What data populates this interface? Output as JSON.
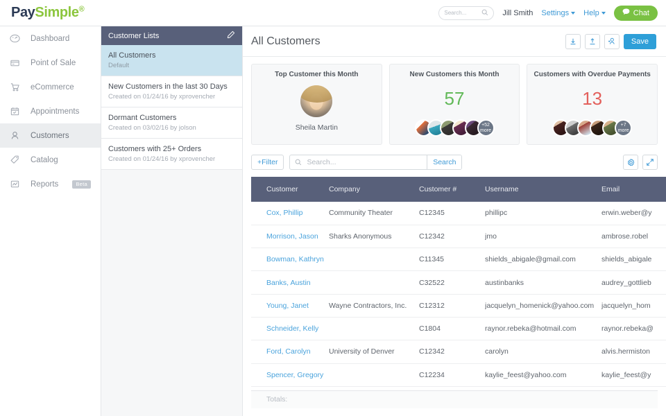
{
  "brand": {
    "part1": "Pay",
    "part2": "Simple",
    "green": "#8cc63e",
    "navy": "#2b3a55"
  },
  "header": {
    "search_placeholder": "Search...",
    "search_value": "",
    "user_name": "Jill Smith",
    "settings_label": "Settings",
    "help_label": "Help",
    "chat_label": "Chat"
  },
  "sidebar": {
    "items": [
      {
        "label": "Dashboard",
        "icon": "gauge-icon",
        "active": false,
        "badge": ""
      },
      {
        "label": "Point of Sale",
        "icon": "credit-card-icon",
        "active": false,
        "badge": ""
      },
      {
        "label": "eCommerce",
        "icon": "cart-icon",
        "active": false,
        "badge": ""
      },
      {
        "label": "Appointments",
        "icon": "calendar-icon",
        "active": false,
        "badge": ""
      },
      {
        "label": "Customers",
        "icon": "person-icon",
        "active": true,
        "badge": ""
      },
      {
        "label": "Catalog",
        "icon": "tag-icon",
        "active": false,
        "badge": ""
      },
      {
        "label": "Reports",
        "icon": "chart-icon",
        "active": false,
        "badge": "Beta"
      }
    ]
  },
  "list_panel": {
    "header_title": "Customer Lists",
    "edit_icon": "pencil-icon",
    "items": [
      {
        "title": "All Customers",
        "sub": "Default",
        "selected": true
      },
      {
        "title": "New Customers in the last 30 Days",
        "sub": "Created on 01/24/16 by xprovencher",
        "selected": false
      },
      {
        "title": "Dormant Customers",
        "sub": "Created on 03/02/16 by jolson",
        "selected": false
      },
      {
        "title": "Customers with 25+ Orders",
        "sub": "Created on 01/24/16 by xprovencher",
        "selected": false
      }
    ]
  },
  "main": {
    "title": "All Customers",
    "actions": {
      "import_icon": "download-icon",
      "export_icon": "upload-icon",
      "add_customer_icon": "add-person-icon",
      "save_label": "Save"
    },
    "cards": [
      {
        "title": "Top Customer this Month",
        "type": "photo",
        "name": "Sheila Martin"
      },
      {
        "title": "New Customers this Month",
        "type": "count",
        "value": "57",
        "color": "#62b959",
        "more": "+52",
        "more_label": "more"
      },
      {
        "title": "Customers with Overdue Payments",
        "type": "count",
        "value": "13",
        "color": "#e3605c",
        "more": "+7",
        "more_label": "more"
      }
    ],
    "toolbar": {
      "filter_label": "+Filter",
      "search_placeholder": "Search...",
      "search_value": "",
      "search_button": "Search",
      "settings_icon": "gear-icon",
      "expand_icon": "expand-icon"
    },
    "table": {
      "columns": [
        "Customer",
        "Company",
        "Customer #",
        "Username",
        "Email"
      ],
      "rows": [
        {
          "customer": "Cox, Phillip",
          "company": "Community Theater",
          "number": "C12345",
          "username": "phillipc",
          "email": "erwin.weber@y"
        },
        {
          "customer": "Morrison, Jason",
          "company": "Sharks Anonymous",
          "number": "C12342",
          "username": "jmo",
          "email": "ambrose.robel"
        },
        {
          "customer": "Bowman, Kathryn",
          "company": "",
          "number": "C11345",
          "username": "shields_abigale@gmail.com",
          "email": "shields_abigale"
        },
        {
          "customer": "Banks, Austin",
          "company": "",
          "number": "C32522",
          "username": "austinbanks",
          "email": "audrey_gottlieb"
        },
        {
          "customer": "Young, Janet",
          "company": "Wayne Contractors, Inc.",
          "number": "C12312",
          "username": "jacquelyn_homenick@yahoo.com",
          "email": "jacquelyn_hom"
        },
        {
          "customer": "Schneider, Kelly",
          "company": "",
          "number": "C1804",
          "username": "raynor.rebeka@hotmail.com",
          "email": "raynor.rebeka@"
        },
        {
          "customer": "Ford, Carolyn",
          "company": "University of Denver",
          "number": "C12342",
          "username": "carolyn",
          "email": "alvis.hermiston"
        },
        {
          "customer": "Spencer, Gregory",
          "company": "",
          "number": "C12234",
          "username": "kaylie_feest@yahoo.com",
          "email": "kaylie_feest@y"
        }
      ],
      "totals_label": "Totals:"
    }
  }
}
